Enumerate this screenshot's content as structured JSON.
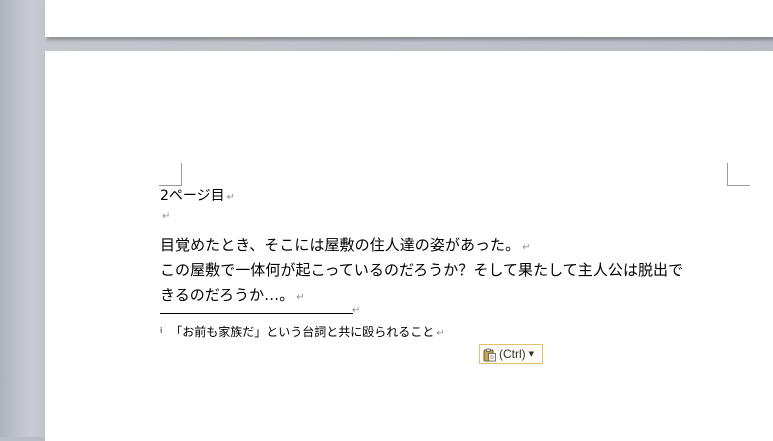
{
  "document": {
    "heading": "2ページ目",
    "lines": [
      "目覚めたとき、そこには屋敷の住人達の姿があった。",
      "この屋敷で一体何が起こっているのだろうか？そして果たして主人公は脱出で",
      "きるのだろうか…。"
    ],
    "paragraph_mark": "↵",
    "footnote": {
      "number": "i",
      "text": "「お前も家族だ」という台詞と共に殴られること"
    }
  },
  "paste_options": {
    "label": "(Ctrl)",
    "icon": "clipboard-paste-icon"
  },
  "colors": {
    "background": "#b9bdc4",
    "page": "#ffffff",
    "formatting_marks": "#8e8e8e",
    "paste_border": "#e3c16a"
  }
}
